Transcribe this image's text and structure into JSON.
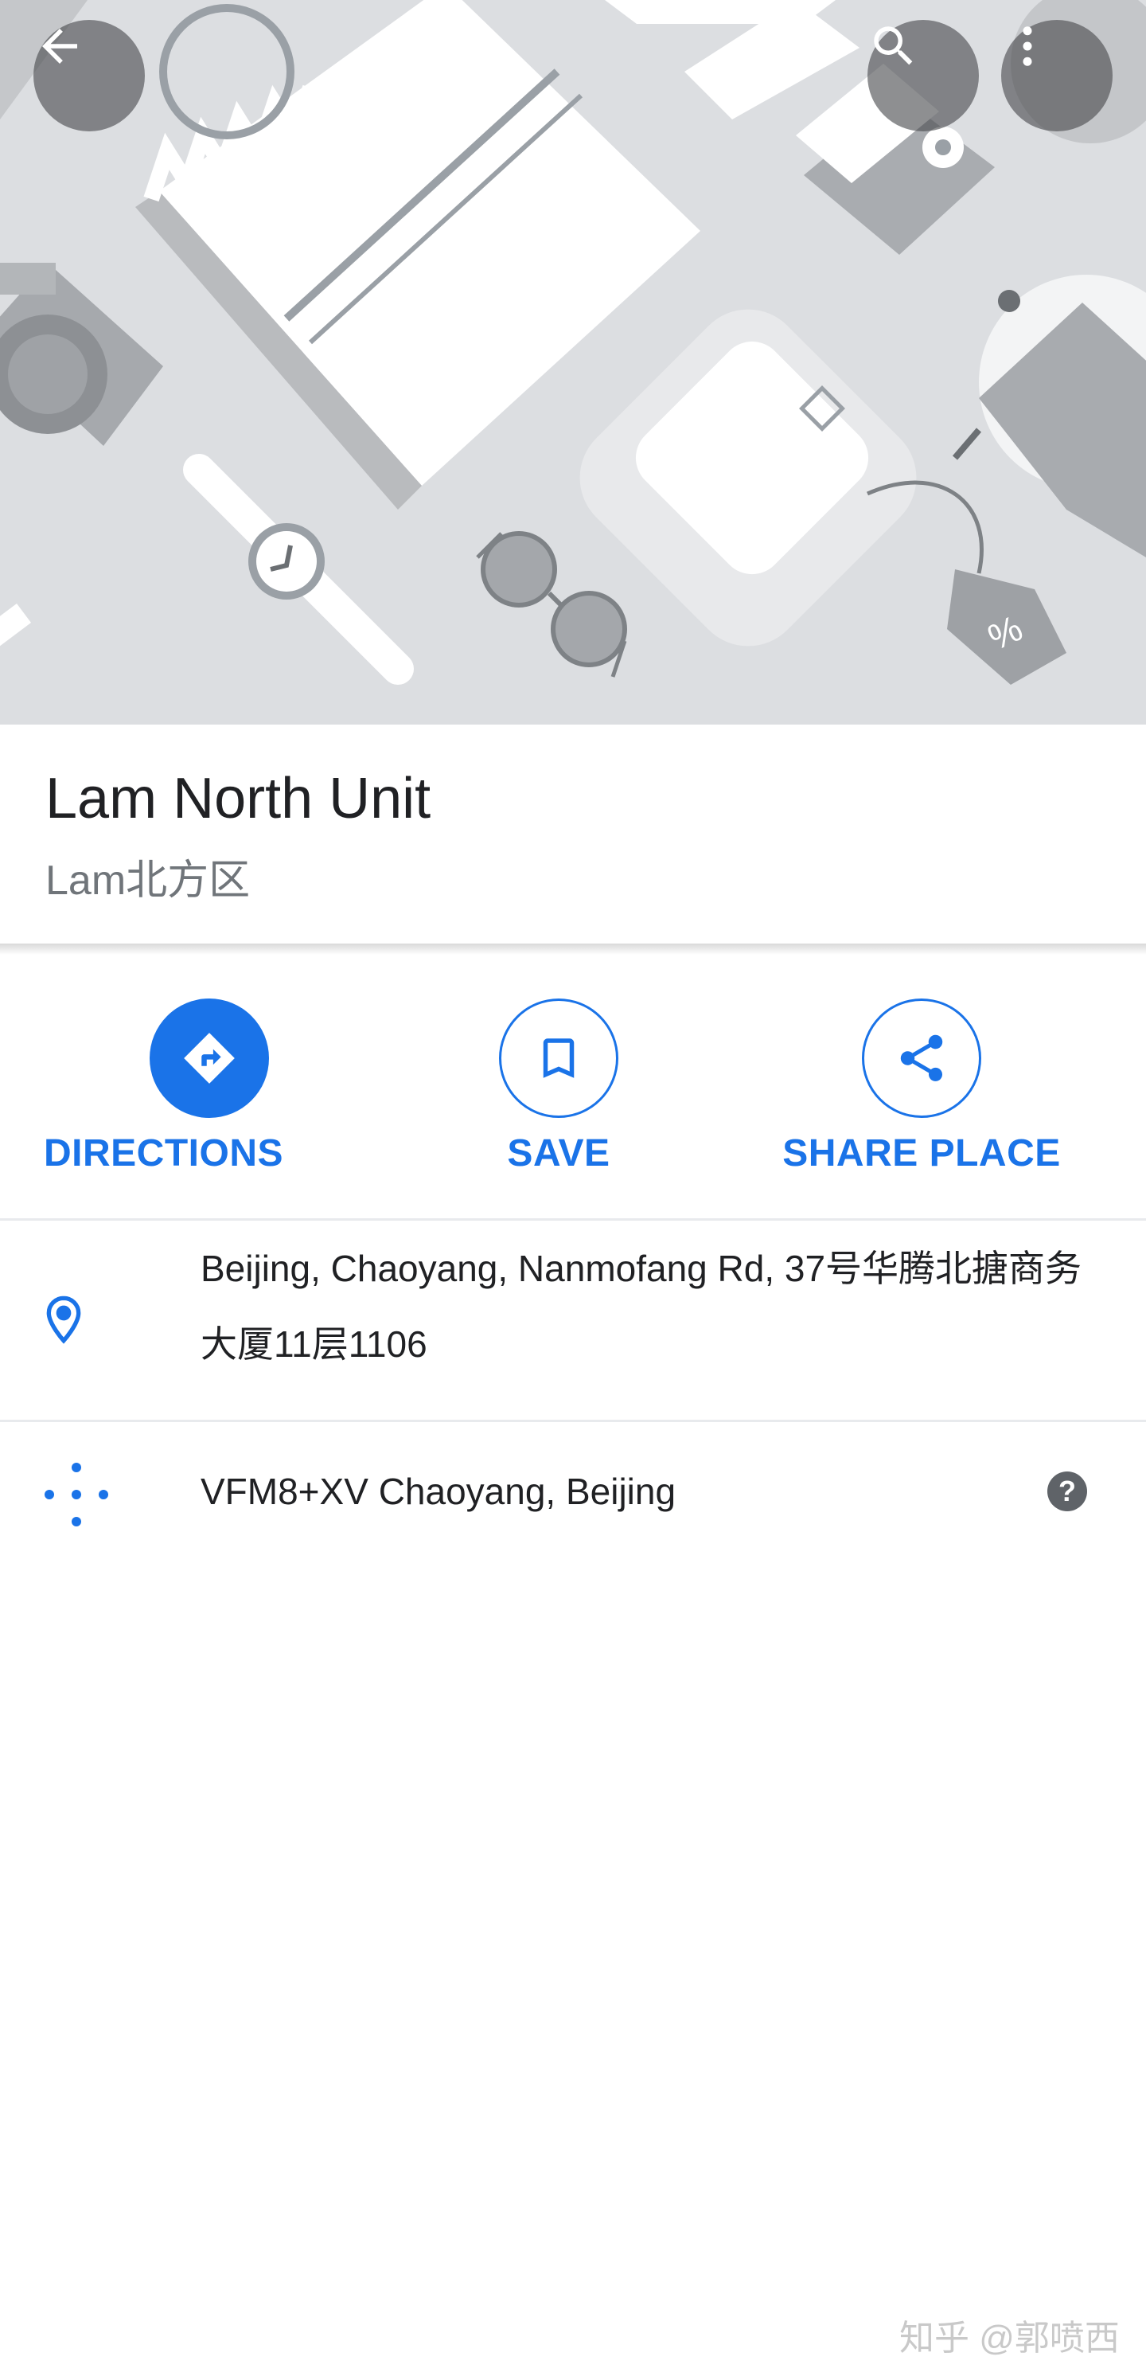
{
  "place": {
    "name": "Lam North Unit",
    "subtitle": "Lam北方区"
  },
  "header": {
    "back_icon": "arrow-back-icon",
    "search_icon": "search-icon",
    "more_icon": "more-vert-icon"
  },
  "actions": [
    {
      "label": "DIRECTIONS",
      "icon": "directions-icon"
    },
    {
      "label": "SAVE",
      "icon": "bookmark-icon"
    },
    {
      "label": "SHARE PLACE",
      "icon": "share-icon"
    }
  ],
  "info": {
    "address": "Beijing, Chaoyang, Nanmofang Rd, 37号华腾北搪商务大厦11层1106",
    "plus_code": "VFM8+XV Chaoyang, Beijing",
    "help_glyph": "?"
  },
  "watermark": "知乎 @郭喷西",
  "colors": {
    "accent": "#1a73e8",
    "hero_bg": "#dcdee1",
    "title_text": "#202124",
    "secondary_text": "#70757a"
  }
}
